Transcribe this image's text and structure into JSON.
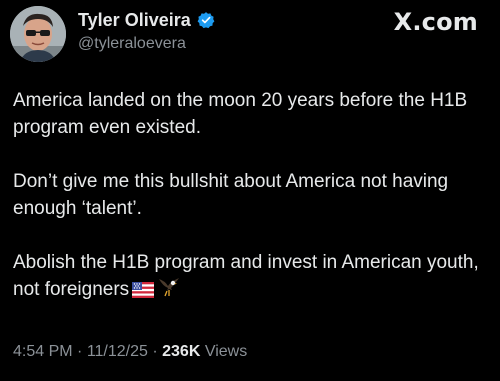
{
  "header": {
    "display_name": "Tyler Oliveira",
    "handle": "@tyleraloevera",
    "brand": "X.com",
    "verified_color": "#1d9bf0"
  },
  "tweet": {
    "paragraphs": [
      "America landed on the moon 20 years before the H1B program even existed.",
      "Don’t give me this bullshit about America not having enough ‘talent’.",
      "Abolish the H1B program and invest in American youth, not foreigners"
    ],
    "emojis": [
      "us-flag-icon",
      "eagle-icon"
    ]
  },
  "meta": {
    "time": "4:54 PM",
    "separator": " · ",
    "date": "11/12/25",
    "views_count": "236K",
    "views_label": "Views"
  },
  "colors": {
    "background": "#000000",
    "text": "#e7e9ea",
    "secondary": "#8b9197"
  }
}
